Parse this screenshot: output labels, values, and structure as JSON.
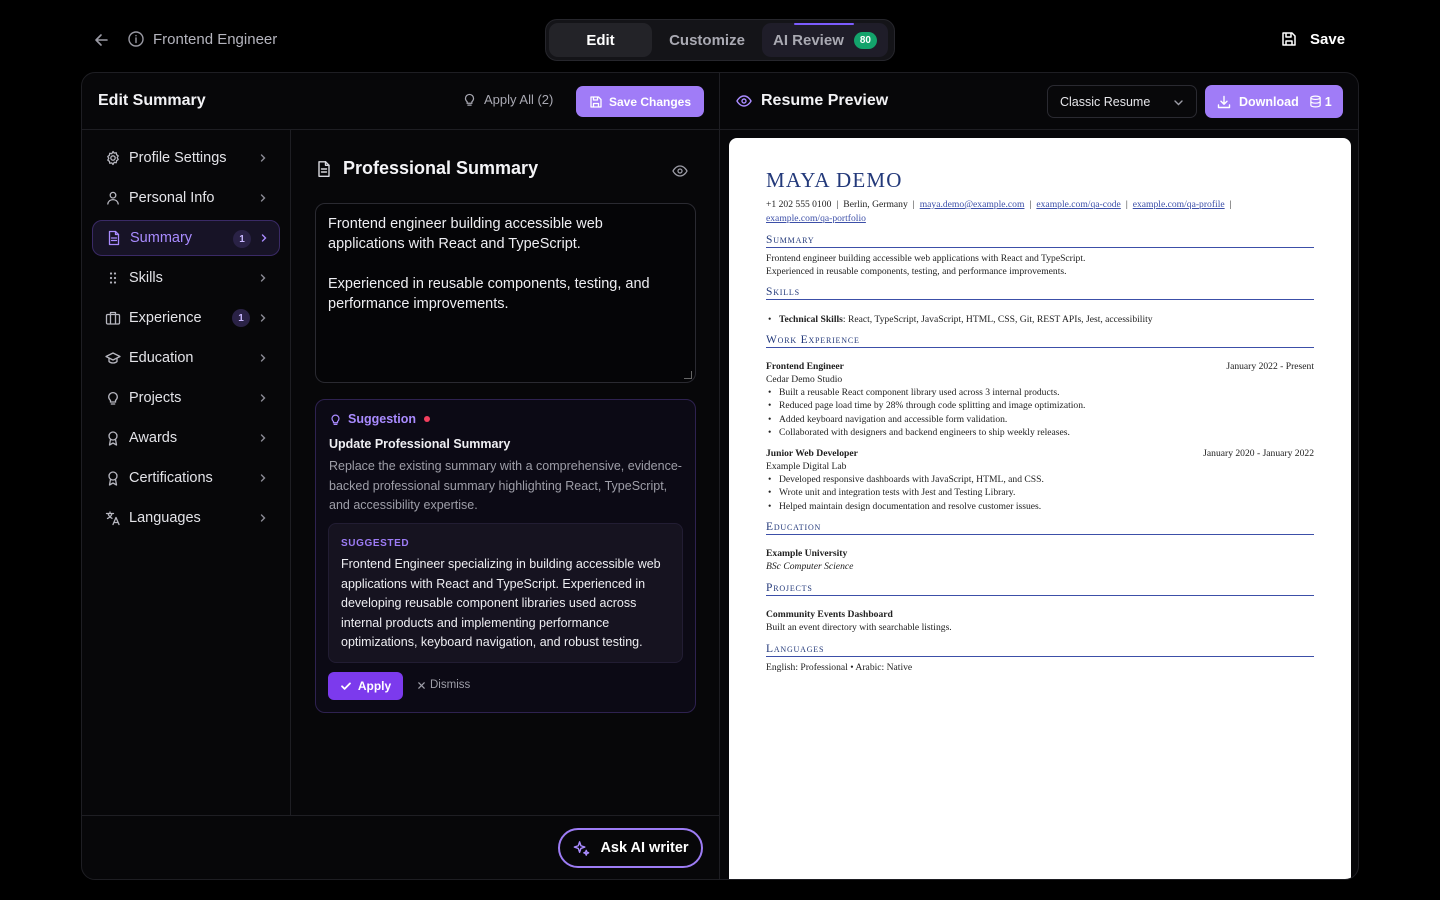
{
  "topbar": {
    "title": "Frontend Engineer",
    "tabs": [
      {
        "label": "Edit"
      },
      {
        "label": "Customize"
      },
      {
        "label": "AI Review",
        "score": "80"
      }
    ],
    "save_label": "Save"
  },
  "left_panel": {
    "title": "Edit Summary",
    "apply_all_label": "Apply All (2)",
    "save_changes_label": "Save Changes"
  },
  "sidebar": {
    "items": [
      {
        "label": "Profile Settings",
        "icon": "gear-icon"
      },
      {
        "label": "Personal Info",
        "icon": "user-icon"
      },
      {
        "label": "Summary",
        "icon": "document-icon",
        "count": "1",
        "active": true
      },
      {
        "label": "Skills",
        "icon": "grip-icon"
      },
      {
        "label": "Experience",
        "icon": "briefcase-icon",
        "count": "1"
      },
      {
        "label": "Education",
        "icon": "graduation-cap-icon"
      },
      {
        "label": "Projects",
        "icon": "lightbulb-icon"
      },
      {
        "label": "Awards",
        "icon": "award-icon"
      },
      {
        "label": "Certifications",
        "icon": "certificate-icon"
      },
      {
        "label": "Languages",
        "icon": "translate-icon"
      }
    ]
  },
  "editor": {
    "section_title": "Professional Summary",
    "summary_paragraphs": [
      "Frontend engineer building accessible web applications with React and TypeScript.",
      "Experienced in reusable components, testing, and performance improvements."
    ],
    "suggestion": {
      "header": "Suggestion",
      "title": "Update Professional Summary",
      "description": "Replace the existing summary with a comprehensive, evidence-backed professional summary highlighting React, TypeScript, and accessibility expertise.",
      "suggested_label": "SUGGESTED",
      "suggested_text": "Frontend Engineer specializing in building accessible web applications with React and TypeScript. Experienced in developing reusable component libraries used across internal products and implementing performance optimizations, keyboard navigation, and robust testing.",
      "apply_label": "Apply",
      "dismiss_label": "Dismiss"
    },
    "ask_ai_label": "Ask AI writer"
  },
  "preview": {
    "title": "Resume Preview",
    "template_select": "Classic Resume",
    "download_label": "Download",
    "download_count": "1",
    "resume": {
      "name": "MAYA DEMO",
      "phone": "+1 202 555 0100",
      "location": "Berlin, Germany",
      "email": "maya.demo@example.com",
      "link1": "example.com/qa-code",
      "link2": "example.com/qa-profile",
      "link3": "example.com/qa-portfolio",
      "summary_heading": "Summary",
      "summary_lines": [
        "Frontend engineer building accessible web applications with React and TypeScript.",
        "Experienced in reusable components, testing, and performance improvements."
      ],
      "skills_heading": "Skills",
      "skills_label": "Technical Skills",
      "skills_value": ": React, TypeScript, JavaScript, HTML, CSS, Git, REST APIs, Jest, accessibility",
      "work_heading": "Work Experience",
      "jobs": [
        {
          "title": "Frontend Engineer",
          "dates": "January 2022 - Present",
          "company": "Cedar Demo Studio",
          "bullets": [
            "Built a reusable React component library used across 3 internal products.",
            "Reduced page load time by 28% through code splitting and image optimization.",
            "Added keyboard navigation and accessible form validation.",
            "Collaborated with designers and backend engineers to ship weekly releases."
          ]
        },
        {
          "title": "Junior Web Developer",
          "dates": "January 2020 - January 2022",
          "company": "Example Digital Lab",
          "bullets": [
            "Developed responsive dashboards with JavaScript, HTML, and CSS.",
            "Wrote unit and integration tests with Jest and Testing Library.",
            "Helped maintain design documentation and resolve customer issues."
          ]
        }
      ],
      "education_heading": "Education",
      "school": "Example University",
      "degree": "BSc Computer Science",
      "projects_heading": "Projects",
      "project_name": "Community Events Dashboard",
      "project_desc": "Built an event directory with searchable listings.",
      "languages_heading": "Languages",
      "languages_line": "English: Professional  •  Arabic: Native"
    }
  }
}
